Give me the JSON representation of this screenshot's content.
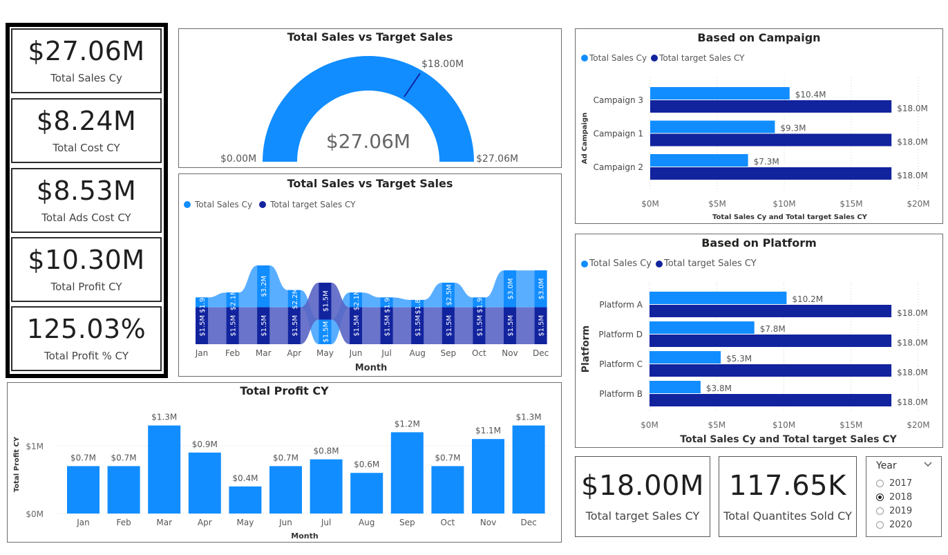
{
  "kpis": [
    {
      "value": "$27.06M",
      "label": "Total Sales Cy"
    },
    {
      "value": "$8.24M",
      "label": "Total Cost CY"
    },
    {
      "value": "$8.53M",
      "label": "Total Ads Cost CY"
    },
    {
      "value": "$10.30M",
      "label": "Total Profit CY"
    },
    {
      "value": "125.03%",
      "label": "Total Profit % CY"
    }
  ],
  "bottom_kpis": [
    {
      "value": "$18.00M",
      "label": "Total target Sales CY"
    },
    {
      "value": "117.65K",
      "label": "Total Quantites Sold CY"
    }
  ],
  "gauge": {
    "title": "Total Sales vs Target Sales",
    "value_label": "$27.06M",
    "min_label": "$0.00M",
    "max_label": "$27.06M",
    "target_label": "$18.00M"
  },
  "ribbon": {
    "title": "Total Sales vs Target Sales",
    "legend": [
      "Total Sales Cy",
      "Total target Sales CY"
    ],
    "xlabel": "Month"
  },
  "campaign": {
    "title": "Based on Campaign",
    "legend": [
      "Total Sales Cy",
      "Total target Sales CY"
    ],
    "ylabel": "Ad Campaign",
    "xlabel": "Total Sales Cy and Total target Sales CY"
  },
  "platform": {
    "title": "Based on Platform",
    "legend": [
      "Total Sales Cy",
      "Total target Sales CY"
    ],
    "ylabel": "Platform",
    "xlabel": "Total Sales Cy and Total target Sales CY"
  },
  "profit": {
    "title": "Total Profit CY",
    "ylabel": "Total Profit CY",
    "xlabel": "Month"
  },
  "slicer": {
    "title": "Year",
    "options": [
      "2017",
      "2018",
      "2019",
      "2020"
    ],
    "selected": "2018"
  },
  "colors": {
    "light": "#118DFF",
    "dark": "#12239E",
    "accent": "#1F8FFF"
  },
  "chart_data": [
    {
      "type": "gauge",
      "title": "Total Sales vs Target Sales",
      "value": 27.06,
      "min": 0,
      "max": 27.06,
      "target": 18.0,
      "unit": "$M"
    },
    {
      "type": "area",
      "title": "Total Sales vs Target Sales",
      "xlabel": "Month",
      "categories": [
        "Jan",
        "Feb",
        "Mar",
        "Apr",
        "May",
        "Jun",
        "Jul",
        "Aug",
        "Sep",
        "Oct",
        "Nov",
        "Dec"
      ],
      "series": [
        {
          "name": "Total Sales Cy",
          "values": [
            1.9,
            2.1,
            3.2,
            2.2,
            1.0,
            2.1,
            1.9,
            1.8,
            2.5,
            1.9,
            3.0,
            3.0
          ],
          "labels": [
            "$1.9M",
            "$2.1M",
            "$3.2M",
            "$2.2M",
            "",
            "$2.1M",
            "$1.9M",
            "$1.8M",
            "$2.5M",
            "$1.9M",
            "$3.0M",
            "$3.0M"
          ]
        },
        {
          "name": "Total target Sales CY",
          "values": [
            1.5,
            1.5,
            1.5,
            1.5,
            1.5,
            1.5,
            1.5,
            1.5,
            1.5,
            1.5,
            1.5,
            1.5
          ],
          "labels": [
            "$1.5M",
            "$1.5M",
            "$1.5M",
            "$1.5M",
            "$1.5M",
            "$1.5M",
            "$1.5M",
            "$1.5M",
            "$1.5M",
            "$1.5M",
            "$1.5M",
            "$1.5M"
          ]
        }
      ],
      "may_sales_label": "$1.5M"
    },
    {
      "type": "bar",
      "title": "Based on Campaign",
      "categories": [
        "Campaign 3",
        "Campaign 1",
        "Campaign 2"
      ],
      "series": [
        {
          "name": "Total Sales Cy",
          "values": [
            10.4,
            9.3,
            7.3
          ],
          "labels": [
            "$10.4M",
            "$9.3M",
            "$7.3M"
          ]
        },
        {
          "name": "Total target Sales CY",
          "values": [
            18.0,
            18.0,
            18.0
          ],
          "labels": [
            "$18.0M",
            "$18.0M",
            "$18.0M"
          ]
        }
      ],
      "xticks": [
        "$0M",
        "$5M",
        "$10M",
        "$15M",
        "$20M"
      ],
      "xlim": [
        0,
        20
      ]
    },
    {
      "type": "bar",
      "title": "Based on Platform",
      "categories": [
        "Platform A",
        "Platform D",
        "Platform C",
        "Platform B"
      ],
      "series": [
        {
          "name": "Total Sales Cy",
          "values": [
            10.2,
            7.8,
            5.3,
            3.8
          ],
          "labels": [
            "$10.2M",
            "$7.8M",
            "$5.3M",
            "$3.8M"
          ]
        },
        {
          "name": "Total target Sales CY",
          "values": [
            18.0,
            18.0,
            18.0,
            18.0
          ],
          "labels": [
            "$18.0M",
            "$18.0M",
            "$18.0M",
            "$18.0M"
          ]
        }
      ],
      "xticks": [
        "$0M",
        "$5M",
        "$10M",
        "$15M",
        "$20M"
      ],
      "xlim": [
        0,
        20
      ]
    },
    {
      "type": "bar",
      "title": "Total Profit CY",
      "categories": [
        "Jan",
        "Feb",
        "Mar",
        "Apr",
        "May",
        "Jun",
        "Jul",
        "Aug",
        "Sep",
        "Oct",
        "Nov",
        "Dec"
      ],
      "values": [
        0.7,
        0.7,
        1.3,
        0.9,
        0.4,
        0.7,
        0.8,
        0.6,
        1.2,
        0.7,
        1.1,
        1.3
      ],
      "labels": [
        "$0.7M",
        "$0.7M",
        "$1.3M",
        "$0.9M",
        "$0.4M",
        "$0.7M",
        "$0.8M",
        "$0.6M",
        "$1.2M",
        "$0.7M",
        "$1.1M",
        "$1.3M"
      ],
      "yticks": [
        "$0M",
        "$1M"
      ],
      "ylim": [
        0,
        1.4
      ]
    }
  ]
}
